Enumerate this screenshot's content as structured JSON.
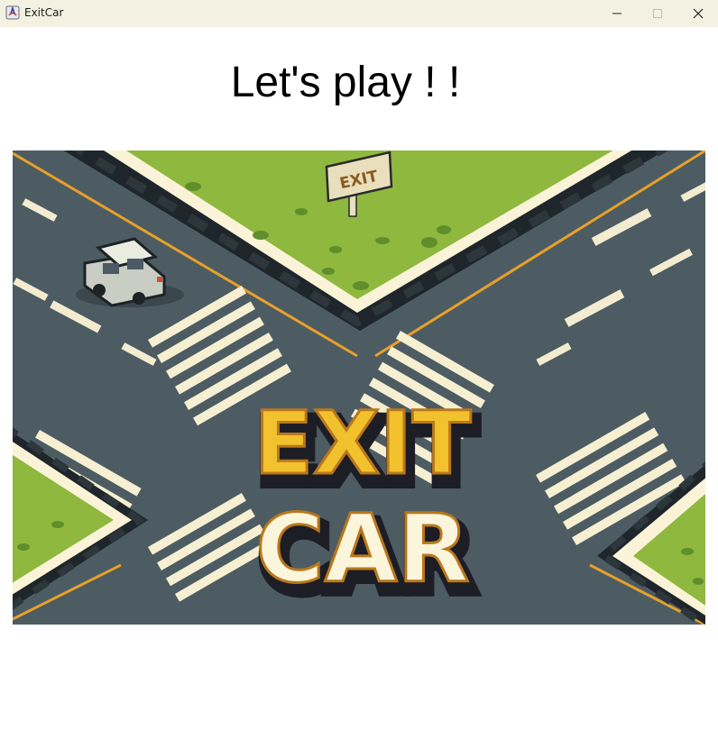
{
  "window": {
    "title": "ExitCar",
    "icon": "java-app-icon",
    "controls": {
      "minimize": "minimize-icon",
      "maximize": "maximize-icon",
      "close": "close-icon"
    }
  },
  "main": {
    "heading": "Let's play ! !",
    "cover_image": {
      "sign_text": "EXIT",
      "logo_line1": "EXIT",
      "logo_line2": "CAR"
    }
  },
  "colors": {
    "titlebar": "#f3f1e1",
    "grass": "#8fb83f",
    "road": "#4c5c62",
    "logo_yellow": "#f2c12e",
    "logo_cream": "#fbf5dc",
    "logo_outline": "#1d1d26"
  }
}
